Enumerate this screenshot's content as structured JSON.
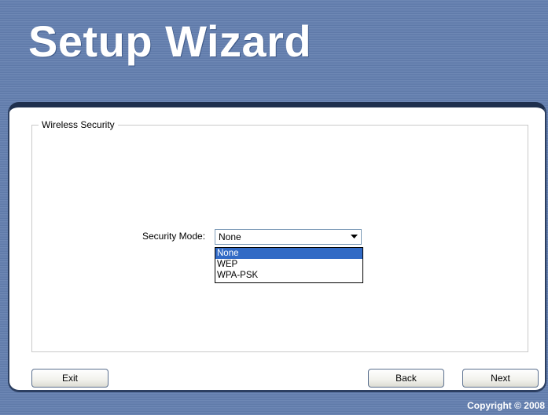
{
  "header": {
    "title": "Setup Wizard"
  },
  "section": {
    "legend": "Wireless Security"
  },
  "security_mode": {
    "label": "Security Mode:",
    "selected": "None",
    "options": [
      "None",
      "WEP",
      "WPA-PSK"
    ],
    "highlighted_index": 0
  },
  "buttons": {
    "exit": "Exit",
    "back": "Back",
    "next": "Next"
  },
  "footer": {
    "copyright": "Copyright © 2008"
  },
  "icons": {
    "dropdown_arrow": "chevron-down-icon"
  }
}
